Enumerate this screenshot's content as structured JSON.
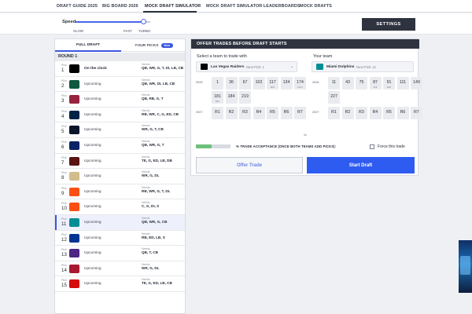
{
  "nav": {
    "items": [
      {
        "label": "DRAFT GUIDE 2025"
      },
      {
        "label": "BIG BOARD 2026"
      },
      {
        "label": "MOCK DRAFT SIMULATOR"
      },
      {
        "label": "MOCK DRAFT SIMULATOR LEADERBOARDS"
      },
      {
        "label": "MOCK DRAFTS"
      }
    ],
    "active_index": 2
  },
  "speed": {
    "label": "Speed",
    "ticks": [
      "SLOW",
      "FAST",
      "TURBO"
    ],
    "value_fraction": 0.92
  },
  "settings_label": "SETTINGS",
  "left": {
    "tabs": [
      {
        "label": "FULL DRAFT"
      },
      {
        "label": "YOUR PICKS"
      }
    ],
    "new_badge": "New",
    "round_label": "ROUND 1",
    "pick_label": "Pick",
    "needs_label": "Needs",
    "picks": [
      {
        "num": "1",
        "status": "On the clock",
        "needs": "QB, WR, G, T, DI, LB, CB",
        "team_color": "#000000",
        "highlight": false
      },
      {
        "num": "2",
        "status": "Upcoming",
        "needs": "QB, WR, DI, LB, CB",
        "team_color": "#125740",
        "highlight": false
      },
      {
        "num": "3",
        "status": "Upcoming",
        "needs": "QB, RB, G, T",
        "team_color": "#97233f",
        "highlight": false
      },
      {
        "num": "4",
        "status": "Upcoming",
        "needs": "RB, WR, C, G, ED, CB",
        "team_color": "#002244",
        "highlight": false
      },
      {
        "num": "5",
        "status": "Upcoming",
        "needs": "WR, G, T, CB",
        "team_color": "#0b162a",
        "highlight": false
      },
      {
        "num": "6",
        "status": "Upcoming",
        "needs": "QB, WR, G, T",
        "team_color": "#0b2265",
        "highlight": false
      },
      {
        "num": "7",
        "status": "Upcoming",
        "needs": "TE, G, ED, LB, DB",
        "team_color": "#5a1414",
        "highlight": false
      },
      {
        "num": "8",
        "status": "Upcoming",
        "needs": "WR, G, DL",
        "team_color": "#d3bc8d",
        "highlight": false
      },
      {
        "num": "9",
        "status": "Upcoming",
        "needs": "RB, WR, G, T, DL",
        "team_color": "#fb4f14",
        "highlight": false
      },
      {
        "num": "10",
        "status": "Upcoming",
        "needs": "C, G, DI, S",
        "team_color": "#fb4f14",
        "highlight": false
      },
      {
        "num": "11",
        "status": "Upcoming",
        "needs": "QB, WR, G, CB",
        "team_color": "#008e97",
        "highlight": true
      },
      {
        "num": "12",
        "status": "Upcoming",
        "needs": "RB, ED, LB, S",
        "team_color": "#003594",
        "highlight": false
      },
      {
        "num": "13",
        "status": "Upcoming",
        "needs": "QB, T, CB",
        "team_color": "#4f2683",
        "highlight": false
      },
      {
        "num": "14",
        "status": "Upcoming",
        "needs": "WR, G, DL",
        "team_color": "#a71930",
        "highlight": false
      },
      {
        "num": "15",
        "status": "Upcoming",
        "needs": "TE, G, ED, LB, CB",
        "team_color": "#d50a0a",
        "highlight": false
      }
    ]
  },
  "trade": {
    "header": "OFFER TRADES BEFORE DRAFT STARTS",
    "left_title": "Select a team to trade with",
    "right_title": "Your team",
    "left_team": {
      "name": "Las Vegas Raiders",
      "next_pick": "Next Pick: 1",
      "color": "#000000"
    },
    "right_team": {
      "name": "Miami Dolphins",
      "next_pick": "Next Pick: 11",
      "color": "#008e97"
    },
    "swap_symbol": "⇆",
    "player_label": "PLAYER",
    "player_placeholder": "Select a player",
    "left_2026_label": "2026",
    "left_2027_label": "2027",
    "right_2026_label": "2026",
    "right_2027_label": "2027",
    "left_2026": [
      {
        "v": "1",
        "sub": ""
      },
      {
        "v": "36",
        "sub": ""
      },
      {
        "v": "67",
        "sub": ""
      },
      {
        "v": "102",
        "sub": ""
      },
      {
        "v": "117",
        "sub": "MIN"
      },
      {
        "v": "134",
        "sub": ""
      },
      {
        "v": "174",
        "sub": "HOU"
      },
      {
        "v": "181",
        "sub": "BAL"
      },
      {
        "v": "184",
        "sub": ""
      },
      {
        "v": "219",
        "sub": ""
      }
    ],
    "left_2027": [
      "R1",
      "R2",
      "R3",
      "R4",
      "R5",
      "R6",
      "R7"
    ],
    "right_2026": [
      {
        "v": "11",
        "sub": ""
      },
      {
        "v": "43",
        "sub": ""
      },
      {
        "v": "75",
        "sub": ""
      },
      {
        "v": "87",
        "sub": "PHI"
      },
      {
        "v": "91",
        "sub": "DET"
      },
      {
        "v": "111",
        "sub": ""
      },
      {
        "v": "149",
        "sub": ""
      },
      {
        "v": "227",
        "sub": ""
      }
    ],
    "right_2027": [
      "R1",
      "R2",
      "R3",
      "R4",
      "R5",
      "R6",
      "R7"
    ],
    "acceptance_text": "% TRADE ACCEPTANCE (ONCE BOTH TEAMS ADD PICKS):",
    "acceptance_fraction": 0.45,
    "force_label": "Force this trade",
    "offer_label": "Offer Trade",
    "start_label": "Start Draft"
  },
  "colors": {
    "accent": "#2f5cf0",
    "dark": "#2f3340",
    "accept": "#6ec07a"
  }
}
